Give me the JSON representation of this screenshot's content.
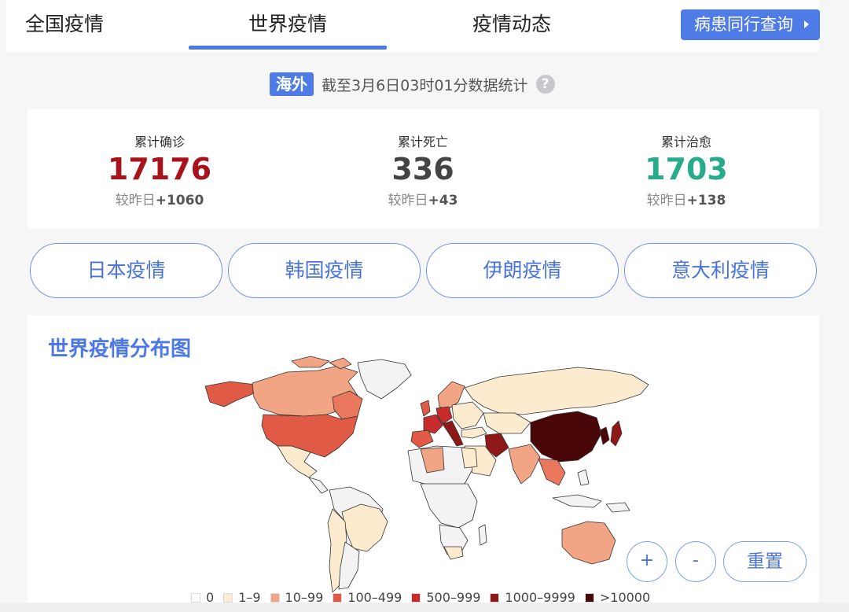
{
  "nav": {
    "tabs": [
      {
        "label": "全国疫情"
      },
      {
        "label": "世界疫情"
      },
      {
        "label": "疫情动态"
      }
    ],
    "active_tab": "世界疫情",
    "cta_label": "病患同行查询"
  },
  "stat_line": {
    "badge": "海外",
    "text": "截至3月6日03时01分数据统计",
    "help_icon": "question-circle-icon"
  },
  "summary": {
    "metrics": [
      {
        "label": "累计确诊",
        "value": "17176",
        "delta_prefix": "较昨日",
        "delta": "+1060",
        "color": "#a8131b"
      },
      {
        "label": "累计死亡",
        "value": "336",
        "delta_prefix": "较昨日",
        "delta": "+43",
        "color": "#444444"
      },
      {
        "label": "累计治愈",
        "value": "1703",
        "delta_prefix": "较昨日",
        "delta": "+138",
        "color": "#27ab8a"
      }
    ]
  },
  "country_buttons": [
    {
      "label": "日本疫情"
    },
    {
      "label": "韩国疫情"
    },
    {
      "label": "伊朗疫情"
    },
    {
      "label": "意大利疫情"
    }
  ],
  "map": {
    "title": "世界疫情分布图",
    "zoom_in_label": "+",
    "zoom_out_label": "-",
    "reset_label": "重置",
    "legend": [
      {
        "label": "0",
        "color": "#ffffff"
      },
      {
        "label": "1–9",
        "color": "#fdebcf"
      },
      {
        "label": "10–99",
        "color": "#f2a584"
      },
      {
        "label": "100–499",
        "color": "#e05a45"
      },
      {
        "label": "500–999",
        "color": "#c72b2b"
      },
      {
        "label": "1000–9999",
        "color": "#8e1717"
      },
      {
        "label": ">10000",
        "color": "#4a0707"
      }
    ]
  },
  "colors": {
    "accent": "#4f7be7",
    "confirmed": "#a8131b",
    "cured": "#27ab8a"
  }
}
